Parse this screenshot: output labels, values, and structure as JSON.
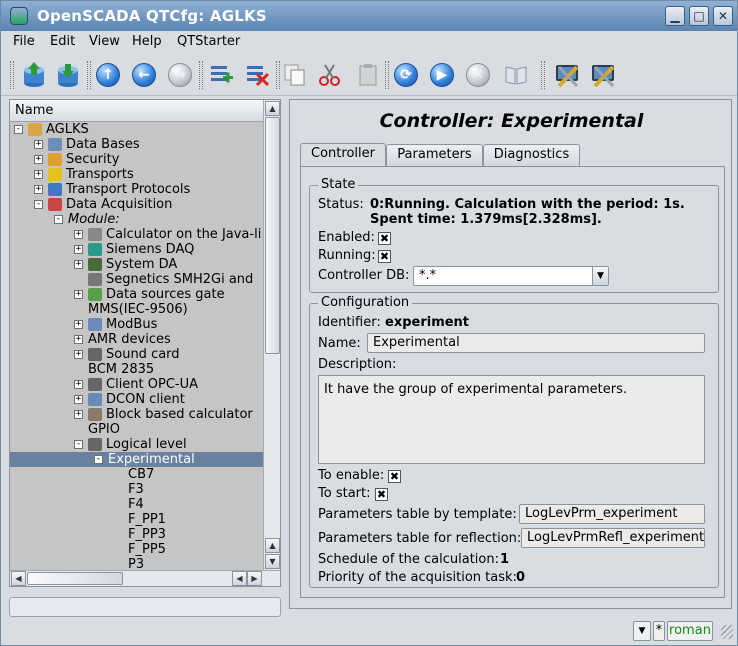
{
  "window": {
    "title": "OpenSCADA QTCfg: AGLKS"
  },
  "menu": {
    "items": [
      "File",
      "Edit",
      "View",
      "Help",
      "QTStarter"
    ]
  },
  "toolbar": {
    "icons": [
      "db-load-icon",
      "db-save-icon",
      "up-icon",
      "back-icon",
      "forward-icon",
      "add-item-icon",
      "delete-item-icon",
      "copy-icon",
      "cut-icon",
      "paste-icon",
      "refresh-icon",
      "start-icon",
      "stop-icon",
      "manual-icon",
      "config-tool-icon",
      "config-tool-2-icon"
    ]
  },
  "tree": {
    "header": "Name",
    "rows": [
      {
        "label": "AGLKS",
        "level": 0,
        "exp": "-",
        "icon": "station-icon",
        "color": "#d9a441"
      },
      {
        "label": "Data Bases",
        "level": 1,
        "exp": "+",
        "icon": "database-icon",
        "color": "#6c8fb5"
      },
      {
        "label": "Security",
        "level": 1,
        "exp": "+",
        "icon": "security-icon",
        "color": "#e0a030"
      },
      {
        "label": "Transports",
        "level": 1,
        "exp": "+",
        "icon": "transports-icon",
        "color": "#e6c21d"
      },
      {
        "label": "Transport Protocols",
        "level": 1,
        "exp": "+",
        "icon": "protocols-icon",
        "color": "#3f78c4"
      },
      {
        "label": "Data Acquisition",
        "level": 1,
        "exp": "-",
        "icon": "daq-icon",
        "color": "#c44"
      },
      {
        "label": "Module:",
        "level": 2,
        "exp": "-",
        "icon": "",
        "italic": true
      },
      {
        "label": "Calculator on the Java-li",
        "level": 3,
        "exp": "+",
        "icon": "calculator-icon",
        "color": "#888"
      },
      {
        "label": "Siemens DAQ",
        "level": 3,
        "exp": "+",
        "icon": "siemens-icon",
        "color": "#2a9a8a"
      },
      {
        "label": "System DA",
        "level": 3,
        "exp": "+",
        "icon": "system-icon",
        "color": "#4a6a3a"
      },
      {
        "label": "Segnetics SMH2Gi and",
        "level": 3,
        "exp": "",
        "icon": "segnetics-icon",
        "color": "#777"
      },
      {
        "label": "Data sources gate",
        "level": 3,
        "exp": "+",
        "icon": "gate-icon",
        "color": "#5aa04a"
      },
      {
        "label": "MMS(IEC-9506)",
        "level": 3,
        "exp": "",
        "icon": ""
      },
      {
        "label": "ModBus",
        "level": 3,
        "exp": "+",
        "icon": "modbus-icon",
        "color": "#6a8aba"
      },
      {
        "label": "AMR devices",
        "level": 3,
        "exp": "+",
        "icon": ""
      },
      {
        "label": "Sound card",
        "level": 3,
        "exp": "+",
        "icon": "sound-icon",
        "color": "#666"
      },
      {
        "label": "BCM 2835",
        "level": 3,
        "exp": "",
        "icon": ""
      },
      {
        "label": "Client OPC-UA",
        "level": 3,
        "exp": "+",
        "icon": "opcua-icon",
        "color": "#666"
      },
      {
        "label": "DCON client",
        "level": 3,
        "exp": "+",
        "icon": "dcon-icon",
        "color": "#6a8aba"
      },
      {
        "label": "Block based calculator",
        "level": 3,
        "exp": "+",
        "icon": "block-calc-icon",
        "color": "#8a7a6a"
      },
      {
        "label": "GPIO",
        "level": 3,
        "exp": "",
        "icon": ""
      },
      {
        "label": "Logical level",
        "level": 3,
        "exp": "-",
        "icon": "logical-level-icon",
        "color": "#666"
      },
      {
        "label": "Experimental",
        "level": 4,
        "exp": "-",
        "icon": "",
        "sel": true
      },
      {
        "label": "CB7",
        "level": 5,
        "exp": "",
        "icon": ""
      },
      {
        "label": "F3",
        "level": 5,
        "exp": "",
        "icon": ""
      },
      {
        "label": "F4",
        "level": 5,
        "exp": "",
        "icon": ""
      },
      {
        "label": "F_PP1",
        "level": 5,
        "exp": "",
        "icon": ""
      },
      {
        "label": "F_PP3",
        "level": 5,
        "exp": "",
        "icon": ""
      },
      {
        "label": "F_PP5",
        "level": 5,
        "exp": "",
        "icon": ""
      },
      {
        "label": "P3",
        "level": 5,
        "exp": "",
        "icon": ""
      }
    ]
  },
  "main": {
    "title": "Controller: Experimental",
    "tabs": [
      "Controller",
      "Parameters",
      "Diagnostics"
    ],
    "state": {
      "group_title": "State",
      "status_label": "Status:",
      "status_line1": "0:Running. Calculation with the period: 1s.",
      "status_line2": "Spent time: 1.379ms[2.328ms].",
      "enabled_label": "Enabled:",
      "enabled": "✖",
      "running_label": "Running:",
      "running": "✖",
      "db_label": "Controller DB:",
      "db_value": "*.*"
    },
    "config": {
      "group_title": "Configuration",
      "identifier_label": "Identifier:",
      "identifier_value": "experiment",
      "name_label": "Name:",
      "name_value": "Experimental",
      "description_label": "Description:",
      "description_value": "It have the group of experimental parameters.",
      "to_enable_label": "To enable:",
      "to_enable": "✖",
      "to_start_label": "To start:",
      "to_start": "✖",
      "prm_template_label": "Parameters table by template:",
      "prm_template_value": "LogLevPrm_experiment",
      "prm_reflection_label": "Parameters table for reflection:",
      "prm_reflection_value": "LogLevPrmRefl_experiment",
      "schedule_label": "Schedule of the calculation:",
      "schedule_value": "1",
      "priority_label": "Priority of the acquisition task:",
      "priority_value": "0"
    }
  },
  "statusbar": {
    "star": "*",
    "user": "roman",
    "user_color": "#1a8a1a"
  }
}
